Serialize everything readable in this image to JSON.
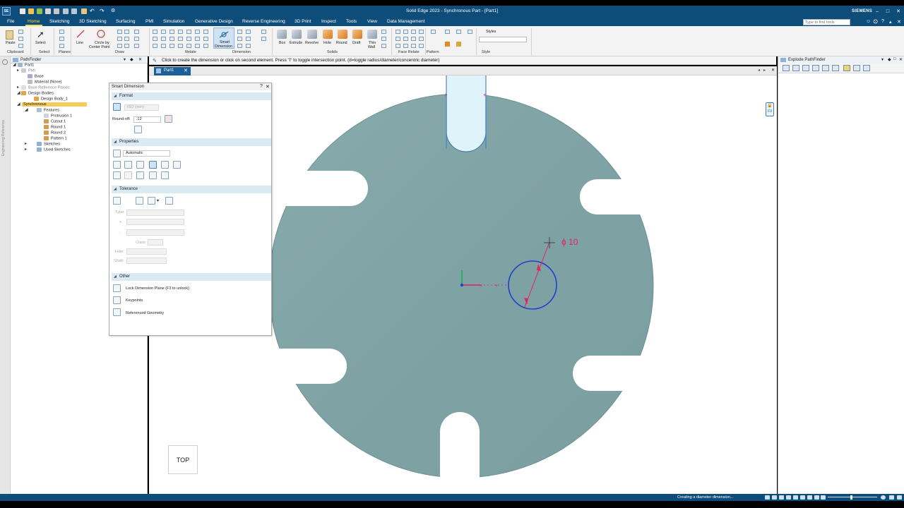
{
  "app": {
    "logo": "SE",
    "title": "Solid Edge 2023 - Synchronous Part - [Part1]",
    "brand": "SIEMENS"
  },
  "menu": {
    "tabs": [
      "File",
      "Home",
      "Sketching",
      "3D Sketching",
      "Surfacing",
      "PMI",
      "Simulation",
      "Generative Design",
      "Reverse Engineering",
      "3D Print",
      "Inspect",
      "Tools",
      "View",
      "Data Management"
    ],
    "active": "Home",
    "search_placeholder": "Type to find tools"
  },
  "ribbon": {
    "groups": {
      "clipboard": "Clipboard",
      "select": "Select",
      "planes": "Planes",
      "draw": "Draw",
      "relate": "Relate",
      "dimension": "Dimension",
      "solids": "Solids",
      "face_relate": "Face Relate",
      "pattern": "Pattern",
      "style": "Style"
    },
    "buttons": {
      "paste": "Paste",
      "select": "Select",
      "line": "Line",
      "circle": "Circle by",
      "circle2": "Center Point",
      "smart_dim": "Smart",
      "smart_dim2": "Dimension",
      "box": "Box",
      "extrude": "Extrude",
      "revolve": "Revolve",
      "hole": "Hole",
      "round": "Round",
      "draft": "Draft",
      "thin_wall": "Thin",
      "thin_wall2": "Wall",
      "styles": "Styles"
    }
  },
  "command_prompt": "Click to create the dimension or click on second element.   Press \"i\" to toggle intersection point. (d=toggle radius/diameter/concentric diameter)",
  "pathfinder": {
    "title": "PathFinder",
    "side_label": "Engineering Reference",
    "tree": [
      {
        "label": "Part1"
      },
      {
        "label": "PMI"
      },
      {
        "label": "Base"
      },
      {
        "label": "Material (None)"
      },
      {
        "label": "Base Reference Planes"
      },
      {
        "label": "Design Bodies"
      },
      {
        "label": "Design Body_1"
      },
      {
        "label": "Synchronous"
      },
      {
        "label": "Features"
      },
      {
        "label": "Protrusion 1"
      },
      {
        "label": "Cutout 1"
      },
      {
        "label": "Round 1"
      },
      {
        "label": "Round 2"
      },
      {
        "label": "Pattern 1"
      },
      {
        "label": "Sketches"
      },
      {
        "label": "Used Sketches"
      }
    ]
  },
  "document": {
    "tab": "Part1"
  },
  "viewport": {
    "view_cube": "TOP",
    "dimension_label": "ϕ 10",
    "lock_label": "F3",
    "part_color": "#7fa2a4",
    "dimension_color": "#e0245e",
    "circle_color": "#2440c8"
  },
  "smart_dimension": {
    "title": "Smart Dimension",
    "sections": {
      "format": "Format",
      "properties": "Properties",
      "tolerance": "Tolerance",
      "other": "Other"
    },
    "format": {
      "units": "ISO (mm)",
      "roundoff_label": "Round-off:",
      "roundoff_value": ".12"
    },
    "properties": {
      "orientation": "Automatic"
    },
    "tolerance": {
      "type_label": "Type:",
      "plus": "+",
      "minus": "-",
      "class_label": "Class:",
      "hole_label": "Hole:",
      "shaft_label": "Shaft:"
    },
    "other": {
      "lock_plane": "Lock Dimension Plane (F3 to unlock)",
      "keypoints": "Keypoints",
      "referenced": "Referenced Geometry"
    }
  },
  "explode_pathfinder": {
    "title": "Explode PathFinder"
  },
  "status": {
    "text": "Creating a diameter dimension..."
  }
}
